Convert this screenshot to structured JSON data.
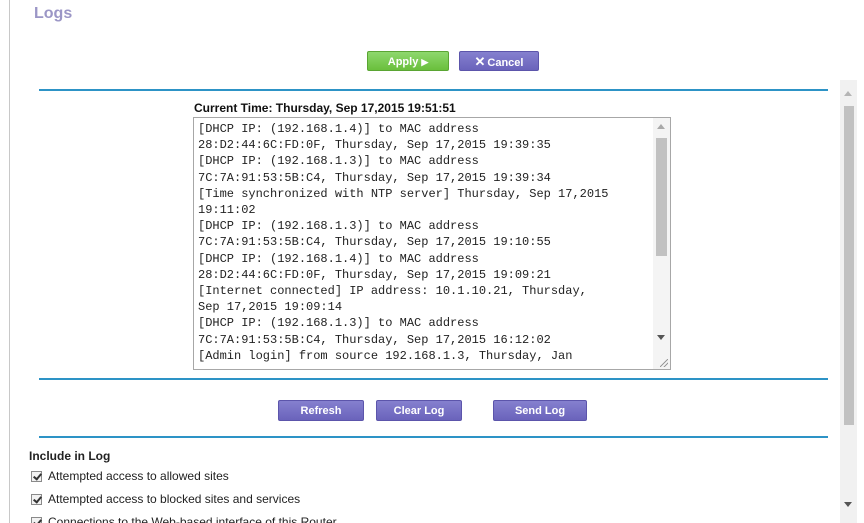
{
  "page": {
    "title": "Logs"
  },
  "toolbar": {
    "apply_label": "Apply",
    "cancel_label": "Cancel"
  },
  "log": {
    "current_time": "Current Time: Thursday, Sep 17,2015 19:51:51",
    "lines": [
      "[DHCP IP: (192.168.1.4)] to MAC address",
      "28:D2:44:6C:FD:0F, Thursday, Sep 17,2015 19:39:35",
      "[DHCP IP: (192.168.1.3)] to MAC address",
      "7C:7A:91:53:5B:C4, Thursday, Sep 17,2015 19:39:34",
      "[Time synchronized with NTP server] Thursday, Sep 17,2015",
      "19:11:02",
      "[DHCP IP: (192.168.1.3)] to MAC address",
      "7C:7A:91:53:5B:C4, Thursday, Sep 17,2015 19:10:55",
      "[DHCP IP: (192.168.1.4)] to MAC address",
      "28:D2:44:6C:FD:0F, Thursday, Sep 17,2015 19:09:21",
      "[Internet connected] IP address: 10.1.10.21, Thursday,",
      "Sep 17,2015 19:09:14",
      "[DHCP IP: (192.168.1.3)] to MAC address",
      "7C:7A:91:53:5B:C4, Thursday, Sep 17,2015 16:12:02",
      "[Admin login] from source 192.168.1.3, Thursday, Jan"
    ]
  },
  "actions": {
    "refresh_label": "Refresh",
    "clear_label": "Clear Log",
    "send_label": "Send Log"
  },
  "include": {
    "title": "Include in Log",
    "options": [
      {
        "label": "Attempted access to allowed sites",
        "checked": true
      },
      {
        "label": "Attempted access to blocked sites and services",
        "checked": true
      },
      {
        "label": "Connections to the Web-based interface of this Router",
        "checked": true
      }
    ]
  },
  "colors": {
    "title": "#9b96c6",
    "apply": "#7acb52",
    "purple_button": "#7670c6",
    "divider": "#2d93c6"
  },
  "icons": {
    "apply": "play-arrow-icon",
    "cancel": "x-icon"
  }
}
